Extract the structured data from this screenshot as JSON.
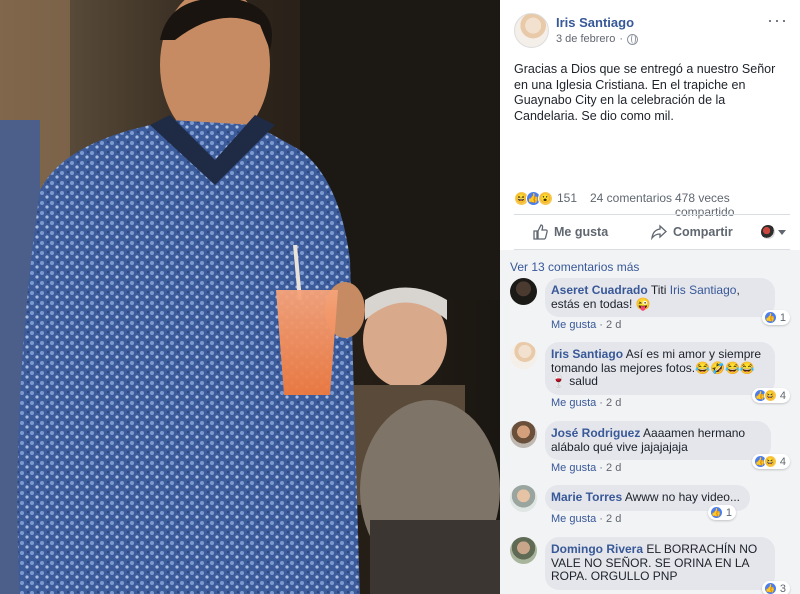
{
  "post": {
    "author": "Iris Santiago",
    "date": "3 de febrero",
    "more": "···",
    "text": "Gracias a Dios que se entregó a nuestro Señor en una Iglesia Cristiana. En el trapiche en Guaynabo City en la celebración de la Candelaria. Se dio como mil.",
    "reaction_count": "151",
    "comments_count": "24 comentarios",
    "shares_count": "478 veces compartido",
    "like_label": "Me gusta",
    "share_label": "Compartir"
  },
  "comments": {
    "more_label": "Ver 13 comentarios más",
    "items": [
      {
        "name": "Aseret Cuadrado",
        "text_pre": "Titi",
        "tag": "Iris Santiago",
        "text_post": ", estás en todas! 😜",
        "like": "Me gusta",
        "age": "2 d",
        "count": "1"
      },
      {
        "name": "Iris Santiago",
        "text_pre": "Así es mi amor y siempre tomando las mejores fotos.😂🤣😂😂🍷 salud",
        "like": "Me gusta",
        "age": "2 d",
        "count": "4"
      },
      {
        "name": "José Rodriguez",
        "text_pre": "Aaaamen hermano alábalo qué vive jajajajaja",
        "like": "Me gusta",
        "age": "2 d",
        "count": "4"
      },
      {
        "name": "Marie Torres",
        "text_pre": "Awww no hay video...",
        "like": "Me gusta",
        "age": "2 d",
        "count": "1"
      },
      {
        "name": "Domingo Rivera",
        "text_pre": "EL BORRACHÍN NO VALE NO SEÑOR. SE ORINA EN LA ROPA. ORGULLO PNP",
        "count": "3"
      }
    ]
  },
  "icons": [
    "more-options-icon",
    "globe-icon",
    "like-thumb-icon",
    "share-arrow-icon",
    "haha-emoji-icon",
    "like-reaction-icon",
    "wow-emoji-icon"
  ],
  "colors": {
    "link": "#385898",
    "bubble": "#e4e6eb",
    "comments_bg": "#f2f3f5",
    "like_blue": "#4a7ef0"
  }
}
